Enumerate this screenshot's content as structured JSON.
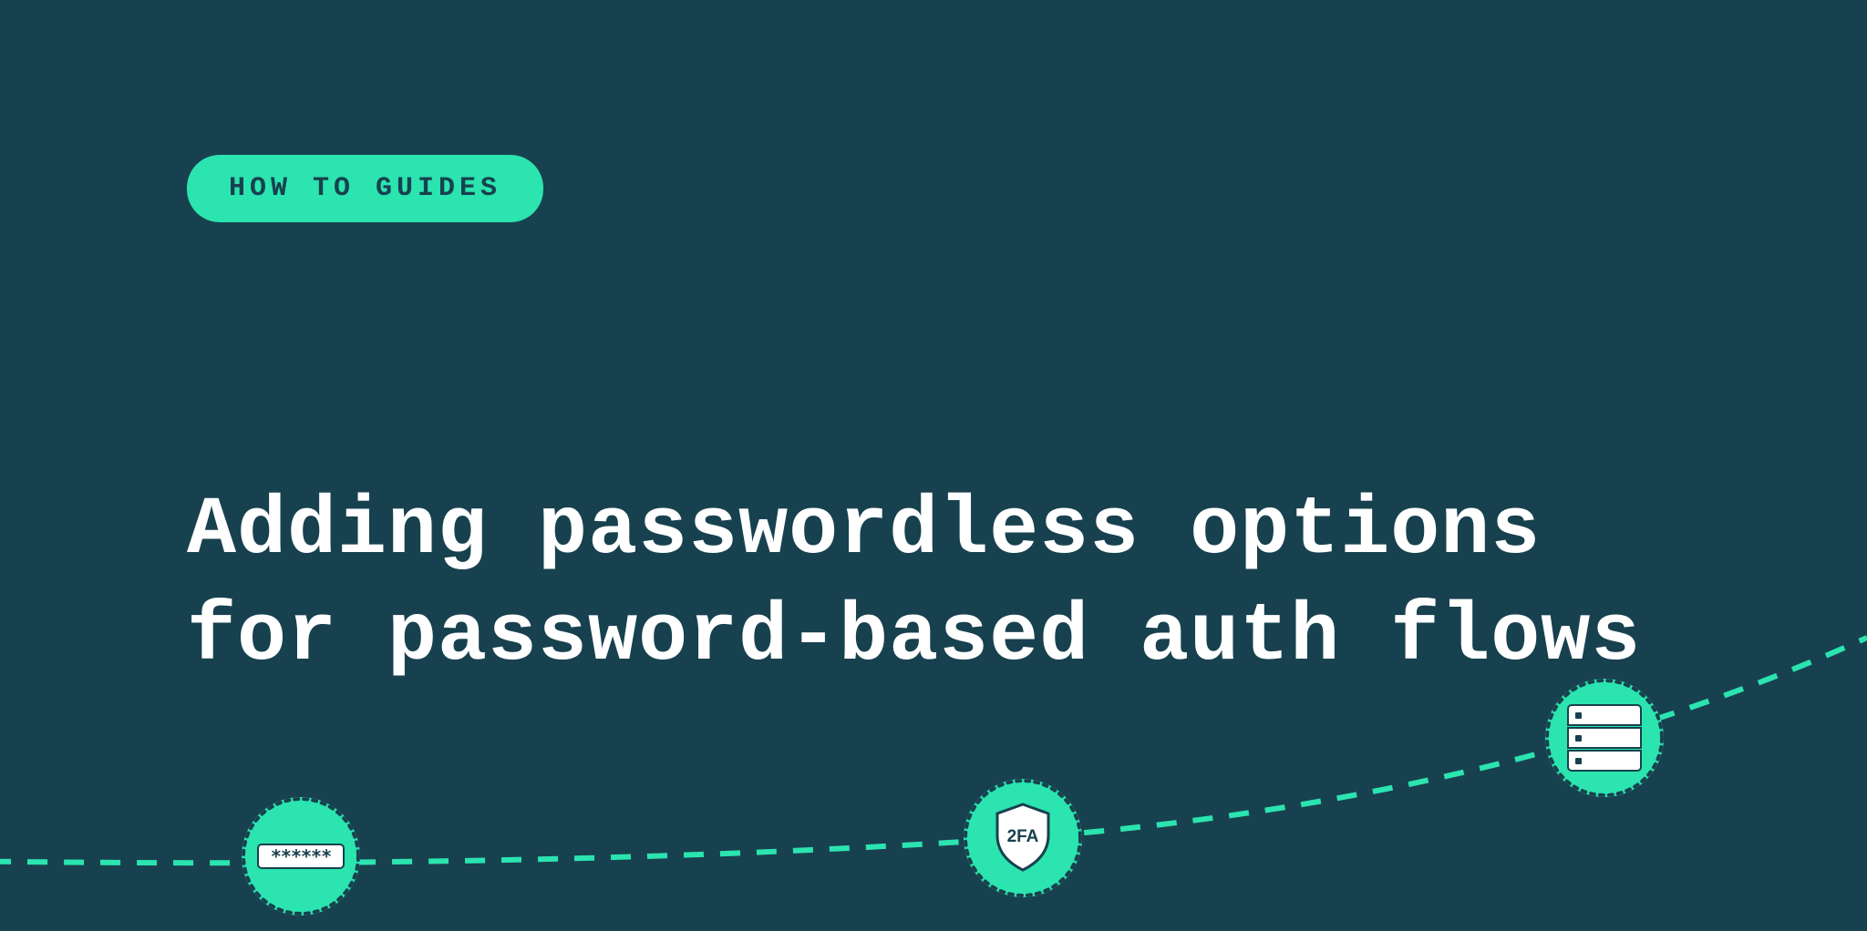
{
  "badge": {
    "label": "HOW TO GUIDES"
  },
  "title": "Adding passwordless options for password-based auth flows",
  "nodes": {
    "password": "******",
    "twofa": "2FA"
  },
  "colors": {
    "background": "#18414f",
    "accent": "#2be4af",
    "text": "#ffffff"
  }
}
